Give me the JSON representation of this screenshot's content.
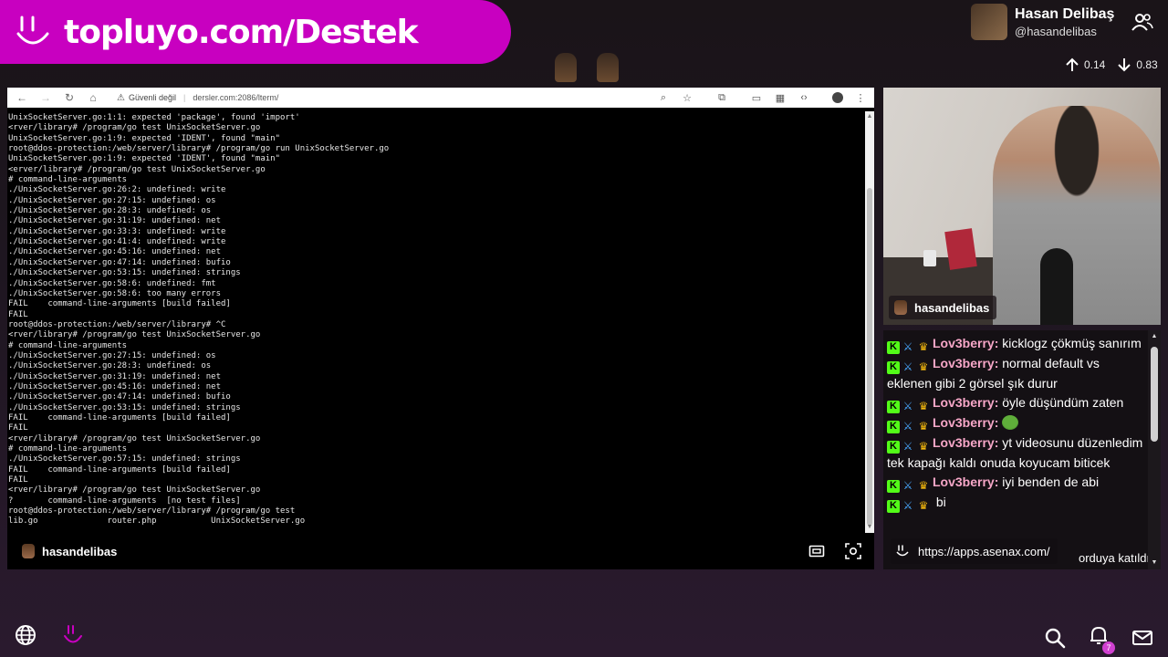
{
  "banner": {
    "text": "topluyo.com/Destek"
  },
  "profile": {
    "name": "Hasan Delibaş",
    "handle": "@hasandelibas"
  },
  "network": {
    "upload": "0.14",
    "download": "0.83"
  },
  "browser": {
    "security_label": "Güvenli değil",
    "url": "dersler.com:2086/lterm/"
  },
  "terminal": {
    "lines": [
      "UnixSocketServer.go:1:1: expected 'package', found 'import'",
      "<rver/library# /program/go test UnixSocketServer.go",
      "UnixSocketServer.go:1:9: expected 'IDENT', found \"main\"",
      "root@ddos-protection:/web/server/library# /program/go run UnixSocketServer.go",
      "UnixSocketServer.go:1:9: expected 'IDENT', found \"main\"",
      "<erver/library# /program/go test UnixSocketServer.go",
      "# command-line-arguments",
      "./UnixSocketServer.go:26:2: undefined: write",
      "./UnixSocketServer.go:27:15: undefined: os",
      "./UnixSocketServer.go:28:3: undefined: os",
      "./UnixSocketServer.go:31:19: undefined: net",
      "./UnixSocketServer.go:33:3: undefined: write",
      "./UnixSocketServer.go:41:4: undefined: write",
      "./UnixSocketServer.go:45:16: undefined: net",
      "./UnixSocketServer.go:47:14: undefined: bufio",
      "./UnixSocketServer.go:53:15: undefined: strings",
      "./UnixSocketServer.go:58:6: undefined: fmt",
      "./UnixSocketServer.go:58:6: too many errors",
      "FAIL    command-line-arguments [build failed]",
      "FAIL",
      "root@ddos-protection:/web/server/library# ^C",
      "<rver/library# /program/go test UnixSocketServer.go",
      "# command-line-arguments",
      "./UnixSocketServer.go:27:15: undefined: os",
      "./UnixSocketServer.go:28:3: undefined: os",
      "./UnixSocketServer.go:31:19: undefined: net",
      "./UnixSocketServer.go:45:16: undefined: net",
      "./UnixSocketServer.go:47:14: undefined: bufio",
      "./UnixSocketServer.go:53:15: undefined: strings",
      "FAIL    command-line-arguments [build failed]",
      "FAIL",
      "<rver/library# /program/go test UnixSocketServer.go",
      "# command-line-arguments",
      "./UnixSocketServer.go:57:15: undefined: strings",
      "FAIL    command-line-arguments [build failed]",
      "FAIL",
      "<rver/library# /program/go test UnixSocketServer.go",
      "?       command-line-arguments  [no test files]",
      "root@ddos-protection:/web/server/library# /program/go test",
      "lib.go              router.php           UnixSocketServer.go"
    ]
  },
  "stream_bar": {
    "name": "hasandelibas"
  },
  "webcam": {
    "label": "hasandelibas"
  },
  "chat": {
    "messages": [
      {
        "user": "Lov3berry:",
        "text": "kicklogz çökmüş sanırım"
      },
      {
        "user": "Lov3berry:",
        "text": "normal default vs eklenen gibi 2 görsel şık durur"
      },
      {
        "user": "Lov3berry:",
        "text": "öyle düşündüm zaten"
      },
      {
        "user": "Lov3berry:",
        "text": "",
        "emote": "frog-emote"
      },
      {
        "user": "Lov3berry:",
        "text": "yt videosunu düzenledim tek kapağı kaldı onuda koyucam biticek"
      },
      {
        "user": "Lov3berry:",
        "text": "iyi benden de abi"
      },
      {
        "user": "",
        "text": "bi"
      }
    ],
    "join_text": "orduya katıldı."
  },
  "tooltip": {
    "url": "https://apps.asenax.com/"
  },
  "notifications": {
    "count": "7"
  },
  "colors": {
    "brand": "#c800c0",
    "chat_user": "#f7a7c8",
    "kick_green": "#53fc18"
  }
}
